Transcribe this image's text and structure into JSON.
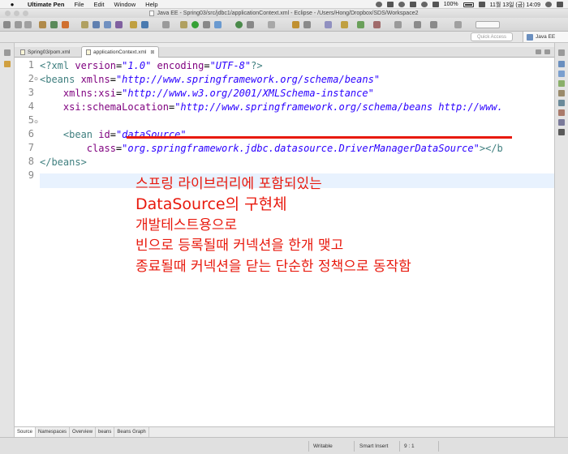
{
  "menubar": {
    "app_name": "Ultimate Pen",
    "items": [
      "File",
      "Edit",
      "Window",
      "Help"
    ],
    "battery": "100%",
    "datetime": "11월 13일 (금)  14:09"
  },
  "window": {
    "title": "Java EE - Spring03/src/jdbc1/applicationContext.xml - Eclipse - /Users/Hong/Dropbox/SDS/Workspace2"
  },
  "toolbar": {
    "quick_access_placeholder": "Quick Access",
    "perspective_label": "Java EE"
  },
  "editor": {
    "tabs": [
      {
        "label": "Spring03/pom.xml"
      },
      {
        "label": "applicationContext.xml",
        "close": "⊠"
      }
    ],
    "line_numbers": [
      "1",
      "2",
      "3",
      "4",
      "5",
      "6",
      "7",
      "8",
      "9"
    ],
    "fold_markers": [
      "⊖",
      "⊖"
    ],
    "code_lines": [
      [
        {
          "t": "<?xml ",
          "c": "k"
        },
        {
          "t": "version",
          "c": "a"
        },
        {
          "t": "=",
          "c": ""
        },
        {
          "t": "\"1.0\"",
          "c": "v"
        },
        {
          "t": " ",
          "c": ""
        },
        {
          "t": "encoding",
          "c": "a"
        },
        {
          "t": "=",
          "c": ""
        },
        {
          "t": "\"UTF-8\"",
          "c": "v"
        },
        {
          "t": "?>",
          "c": "k"
        }
      ],
      [
        {
          "t": "<beans ",
          "c": "k"
        },
        {
          "t": "xmlns",
          "c": "a"
        },
        {
          "t": "=",
          "c": ""
        },
        {
          "t": "\"http://www.springframework.org/schema/beans\"",
          "c": "v"
        }
      ],
      [
        {
          "t": "    ",
          "c": ""
        },
        {
          "t": "xmlns:xsi",
          "c": "a"
        },
        {
          "t": "=",
          "c": ""
        },
        {
          "t": "\"http://www.w3.org/2001/XMLSchema-instance\"",
          "c": "v"
        }
      ],
      [
        {
          "t": "    ",
          "c": ""
        },
        {
          "t": "xsi:schemaLocation",
          "c": "a"
        },
        {
          "t": "=",
          "c": ""
        },
        {
          "t": "\"http://www.springframework.org/schema/beans http://www.",
          "c": "v"
        }
      ],
      [],
      [
        {
          "t": "    <bean ",
          "c": "k"
        },
        {
          "t": "id",
          "c": "a"
        },
        {
          "t": "=",
          "c": ""
        },
        {
          "t": "\"dataSource\"",
          "c": "v"
        }
      ],
      [
        {
          "t": "        ",
          "c": ""
        },
        {
          "t": "class",
          "c": "a"
        },
        {
          "t": "=",
          "c": ""
        },
        {
          "t": "\"org.springframework.jdbc.datasource.DriverManagerDataSource\"",
          "c": "v"
        },
        {
          "t": "></b",
          "c": "k"
        }
      ],
      [
        {
          "t": "</beans>",
          "c": "k"
        }
      ],
      []
    ],
    "annotation_lines": [
      "스프링 라이브러리에 포함되있는",
      "DataSource의 구현체",
      "개발테스트용으로",
      "빈으로 등록될때 커넥션을 한개 맺고",
      "종료될때 커넥션을 닫는 단순한 정책으로 동작함"
    ],
    "annotation_color": "#e8190d"
  },
  "bottom_tabs": [
    "Source",
    "Namespaces",
    "Overview",
    "beans",
    "Beans Graph"
  ],
  "status": {
    "writable": "Writable",
    "insert_mode": "Smart Insert",
    "position": "9 : 1"
  }
}
